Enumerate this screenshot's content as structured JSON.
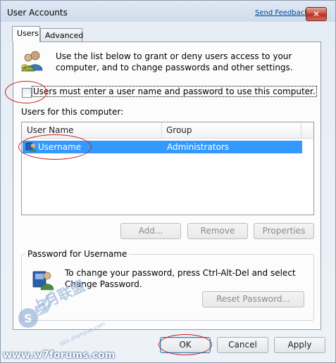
{
  "window": {
    "title": "User Accounts",
    "feedback_link": "Send Feedback",
    "close_glyph": "✕"
  },
  "tabs": [
    {
      "label": "Users",
      "active": true
    },
    {
      "label": "Advanced",
      "active": false
    }
  ],
  "intro_text": "Use the list below to grant or deny users access to your computer, and to change passwords and other settings.",
  "require_login": {
    "label": "Users must enter a user name and password to use this computer.",
    "checked": false
  },
  "users_label": "Users for this computer:",
  "user_list": {
    "columns": [
      "User Name",
      "Group"
    ],
    "rows": [
      {
        "user_name": "Username",
        "group": "Administrators",
        "selected": true
      }
    ]
  },
  "list_buttons": {
    "add": "Add...",
    "remove": "Remove",
    "properties": "Properties"
  },
  "password_group": {
    "title": "Password for Username",
    "text": "To change your password, press Ctrl-Alt-Del and select Change Password.",
    "reset_button": "Reset Password..."
  },
  "footer_buttons": {
    "ok": "OK",
    "cancel": "Cancel",
    "apply": "Apply"
  },
  "watermark": {
    "site": "www.w7forums.com",
    "cn_text": "占月联盟",
    "small_text": "bbs.zhanyue.com"
  },
  "colors": {
    "selection": "#3399ff",
    "annotation_ring": "#cc1d1d",
    "link": "#00469a"
  }
}
